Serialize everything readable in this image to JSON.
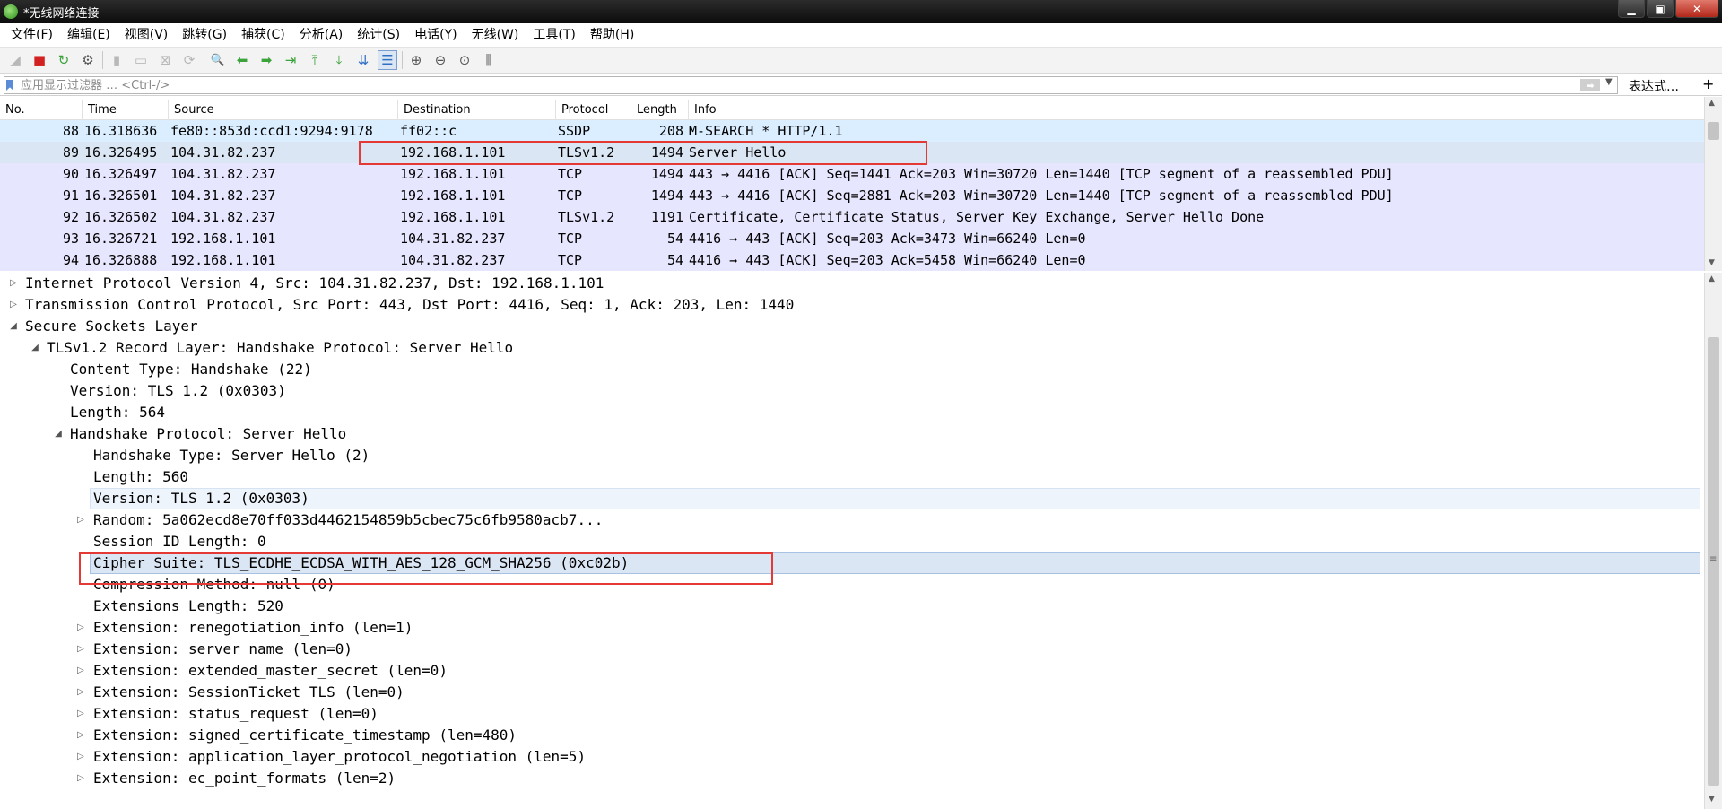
{
  "window": {
    "title": "*无线网络连接",
    "minimize_glyph": "▁",
    "maximize_glyph": "▣",
    "close_glyph": "✕"
  },
  "menu": [
    {
      "label": "文件(F)"
    },
    {
      "label": "编辑(E)"
    },
    {
      "label": "视图(V)"
    },
    {
      "label": "跳转(G)"
    },
    {
      "label": "捕获(C)"
    },
    {
      "label": "分析(A)"
    },
    {
      "label": "统计(S)"
    },
    {
      "label": "电话(Y)"
    },
    {
      "label": "无线(W)"
    },
    {
      "label": "工具(T)"
    },
    {
      "label": "帮助(H)"
    }
  ],
  "toolbar": {
    "icons": [
      {
        "name": "shark-fin-start-icon",
        "glyph": "◢"
      },
      {
        "name": "stop-capture-icon",
        "glyph": "■"
      },
      {
        "name": "restart-capture-icon",
        "glyph": "↻"
      },
      {
        "name": "capture-options-icon",
        "glyph": "⚙"
      },
      {
        "name": "open-file-icon",
        "glyph": "▮"
      },
      {
        "name": "save-file-icon",
        "glyph": "▭"
      },
      {
        "name": "close-file-icon",
        "glyph": "⊠"
      },
      {
        "name": "reload-file-icon",
        "glyph": "⟳"
      },
      {
        "name": "find-packet-icon",
        "glyph": "🔍"
      },
      {
        "name": "go-back-icon",
        "glyph": "⬅"
      },
      {
        "name": "go-forward-icon",
        "glyph": "➡"
      },
      {
        "name": "go-to-packet-icon",
        "glyph": "⇥"
      },
      {
        "name": "go-first-icon",
        "glyph": "⤒"
      },
      {
        "name": "go-last-icon",
        "glyph": "⤓"
      },
      {
        "name": "auto-scroll-icon",
        "glyph": "⇊"
      },
      {
        "name": "colorize-icon",
        "glyph": "☰"
      },
      {
        "name": "zoom-in-icon",
        "glyph": "⊕"
      },
      {
        "name": "zoom-out-icon",
        "glyph": "⊖"
      },
      {
        "name": "zoom-reset-icon",
        "glyph": "⊙"
      },
      {
        "name": "resize-columns-icon",
        "glyph": "⫼"
      }
    ],
    "colors": {
      "stop": "#d32020",
      "green": "#3aa33a",
      "blue": "#2f6fc4"
    }
  },
  "filter": {
    "placeholder": "应用显示过滤器 … <Ctrl-/>",
    "apply_glyph": "➡",
    "dropdown_glyph": "▼",
    "expression_label": "表达式…",
    "add_glyph": "+"
  },
  "packet_list": {
    "columns": [
      "No.",
      "Time",
      "Source",
      "Destination",
      "Protocol",
      "Length",
      "Info"
    ],
    "rows": [
      {
        "no": "88",
        "time": "16.318636",
        "source": "fe80::853d:ccd1:9294:9178",
        "destination": "ff02::c",
        "protocol": "SSDP",
        "length": "208",
        "info": "M-SEARCH * HTTP/1.1"
      },
      {
        "no": "89",
        "time": "16.326495",
        "source": "104.31.82.237",
        "destination": "192.168.1.101",
        "protocol": "TLSv1.2",
        "length": "1494",
        "info": "Server Hello"
      },
      {
        "no": "90",
        "time": "16.326497",
        "source": "104.31.82.237",
        "destination": "192.168.1.101",
        "protocol": "TCP",
        "length": "1494",
        "info": "443 → 4416 [ACK] Seq=1441 Ack=203 Win=30720 Len=1440 [TCP segment of a reassembled PDU]"
      },
      {
        "no": "91",
        "time": "16.326501",
        "source": "104.31.82.237",
        "destination": "192.168.1.101",
        "protocol": "TCP",
        "length": "1494",
        "info": "443 → 4416 [ACK] Seq=2881 Ack=203 Win=30720 Len=1440 [TCP segment of a reassembled PDU]"
      },
      {
        "no": "92",
        "time": "16.326502",
        "source": "104.31.82.237",
        "destination": "192.168.1.101",
        "protocol": "TLSv1.2",
        "length": "1191",
        "info": "Certificate, Certificate Status, Server Key Exchange, Server Hello Done"
      },
      {
        "no": "93",
        "time": "16.326721",
        "source": "192.168.1.101",
        "destination": "104.31.82.237",
        "protocol": "TCP",
        "length": "54",
        "info": "4416 → 443 [ACK] Seq=203 Ack=3473 Win=66240 Len=0"
      },
      {
        "no": "94",
        "time": "16.326888",
        "source": "192.168.1.101",
        "destination": "104.31.82.237",
        "protocol": "TCP",
        "length": "54",
        "info": "4416 → 443 [ACK] Seq=203 Ack=5458 Win=66240 Len=0"
      }
    ],
    "row_colors": {
      "ssdp": "#daeeff",
      "tcp": "#e7e6ff",
      "selected": "#dbe6f5"
    }
  },
  "details": {
    "rows": [
      {
        "text": "Internet Protocol Version 4, Src: 104.31.82.237, Dst: 192.168.1.101",
        "expander": "▷"
      },
      {
        "text": "Transmission Control Protocol, Src Port: 443, Dst Port: 4416, Seq: 1, Ack: 203, Len: 1440",
        "expander": "▷"
      },
      {
        "text": "Secure Sockets Layer",
        "expander": "◢"
      },
      {
        "text": "TLSv1.2 Record Layer: Handshake Protocol: Server Hello",
        "expander": "◢"
      },
      {
        "text": "Content Type: Handshake (22)",
        "expander": ""
      },
      {
        "text": "Version: TLS 1.2 (0x0303)",
        "expander": ""
      },
      {
        "text": "Length: 564",
        "expander": ""
      },
      {
        "text": "Handshake Protocol: Server Hello",
        "expander": "◢"
      },
      {
        "text": "Handshake Type: Server Hello (2)",
        "expander": ""
      },
      {
        "text": "Length: 560",
        "expander": ""
      },
      {
        "text": "Version: TLS 1.2 (0x0303)",
        "expander": ""
      },
      {
        "text": "Random: 5a062ecd8e70ff033d4462154859b5cbec75c6fb9580acb7...",
        "expander": "▷"
      },
      {
        "text": "Session ID Length: 0",
        "expander": ""
      },
      {
        "text": "Cipher Suite: TLS_ECDHE_ECDSA_WITH_AES_128_GCM_SHA256 (0xc02b)",
        "expander": ""
      },
      {
        "text": "Compression Method: null (0)",
        "expander": ""
      },
      {
        "text": "Extensions Length: 520",
        "expander": ""
      },
      {
        "text": "Extension: renegotiation_info (len=1)",
        "expander": "▷"
      },
      {
        "text": "Extension: server_name (len=0)",
        "expander": "▷"
      },
      {
        "text": "Extension: extended_master_secret (len=0)",
        "expander": "▷"
      },
      {
        "text": "Extension: SessionTicket TLS (len=0)",
        "expander": "▷"
      },
      {
        "text": "Extension: status_request (len=0)",
        "expander": "▷"
      },
      {
        "text": "Extension: signed_certificate_timestamp (len=480)",
        "expander": "▷"
      },
      {
        "text": "Extension: application_layer_protocol_negotiation (len=5)",
        "expander": "▷"
      },
      {
        "text": "Extension: ec_point_formats (len=2)",
        "expander": "▷"
      }
    ],
    "grip_glyph": "≡"
  },
  "scroll_glyphs": {
    "up": "▲",
    "down": "▼"
  },
  "annotation_color": "#e53935"
}
